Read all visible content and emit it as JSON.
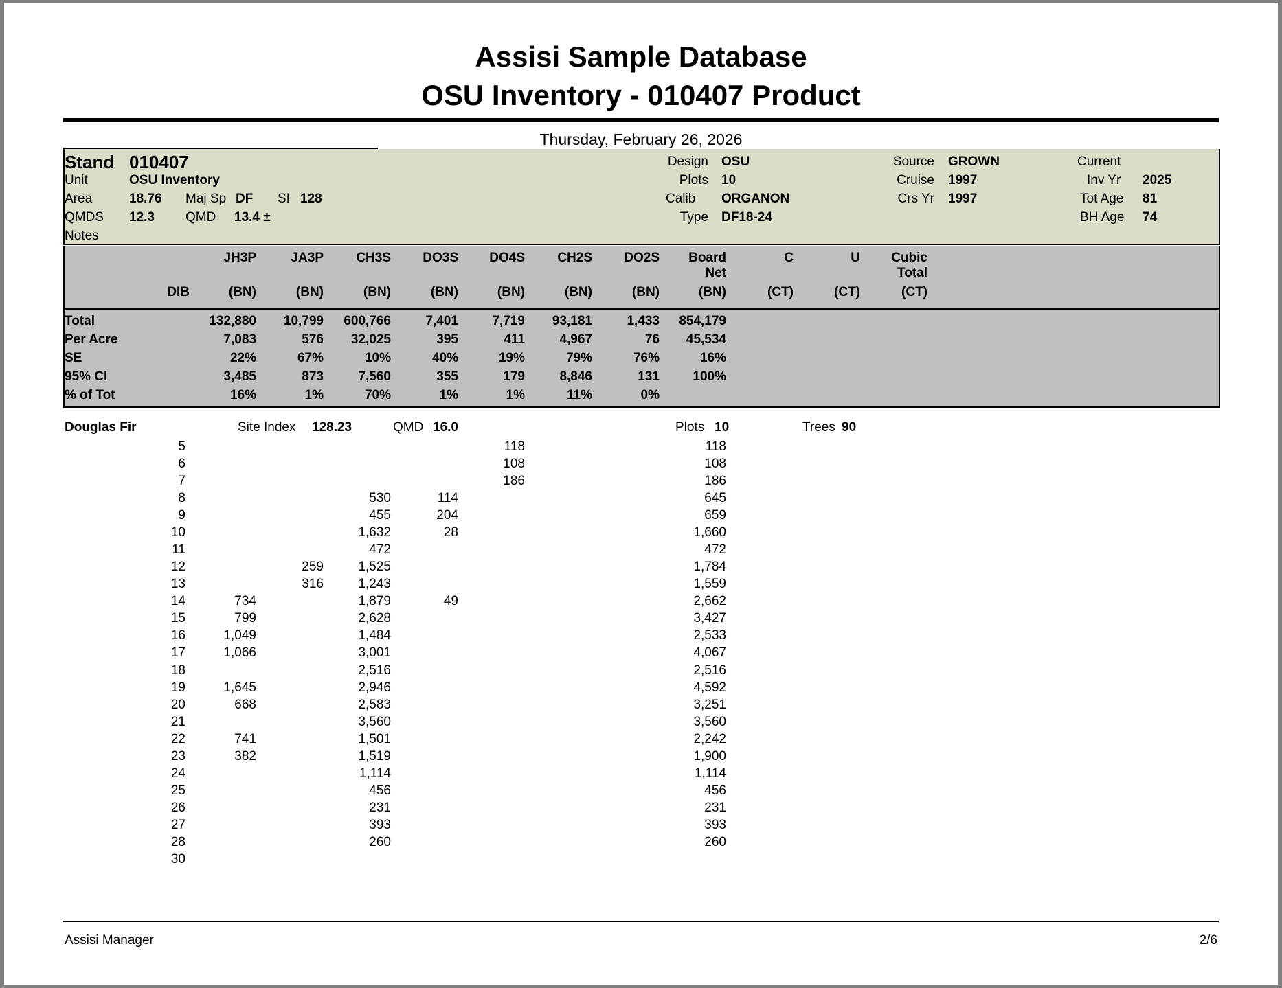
{
  "report": {
    "title_line1": "Assisi Sample Database",
    "title_line2": "OSU Inventory - 010407 Product",
    "date": "Thursday, February 26, 2026"
  },
  "stand": {
    "stand_label": "Stand",
    "stand_value": "010407",
    "unit_label": "Unit",
    "unit_value": "OSU Inventory",
    "area_label": "Area",
    "area_value": "18.76",
    "majsp_label": "Maj Sp",
    "majsp_value": "DF",
    "si_label": "SI",
    "si_value": "128",
    "qmds_label": "QMDS",
    "qmds_value": "12.3",
    "qmd_label": "QMD",
    "qmd_value": "13.4 ±",
    "notes_label": "Notes",
    "design_label": "Design",
    "design_value": "OSU",
    "plots_label": "Plots",
    "plots_value": "10",
    "calib_label": "Calib",
    "calib_value": "ORGANON",
    "type_label": "Type",
    "type_value": "DF18-24",
    "source_label": "Source",
    "source_value": "GROWN",
    "cruise_label": "Cruise",
    "cruise_value": "1997",
    "crsyr_label": "Crs Yr",
    "crsyr_value": "1997",
    "current_label": "Current",
    "invyr_label": "Inv Yr",
    "invyr_value": "2025",
    "totage_label": "Tot Age",
    "totage_value": "81",
    "bhage_label": "BH Age",
    "bhage_value": "74"
  },
  "header": {
    "dib": "DIB",
    "columns": [
      {
        "top": "JH3P",
        "mid": "",
        "unit": "(BN)"
      },
      {
        "top": "JA3P",
        "mid": "",
        "unit": "(BN)"
      },
      {
        "top": "CH3S",
        "mid": "",
        "unit": "(BN)"
      },
      {
        "top": "DO3S",
        "mid": "",
        "unit": "(BN)"
      },
      {
        "top": "DO4S",
        "mid": "",
        "unit": "(BN)"
      },
      {
        "top": "CH2S",
        "mid": "",
        "unit": "(BN)"
      },
      {
        "top": "DO2S",
        "mid": "",
        "unit": "(BN)"
      },
      {
        "top": "Board",
        "mid": "Net",
        "unit": "(BN)"
      },
      {
        "top": "C",
        "mid": "",
        "unit": "(CT)"
      },
      {
        "top": "U",
        "mid": "",
        "unit": "(CT)"
      },
      {
        "top": "Cubic",
        "mid": "Total",
        "unit": "(CT)"
      }
    ]
  },
  "summary": [
    {
      "label": "Total",
      "values": [
        "132,880",
        "10,799",
        "600,766",
        "7,401",
        "7,719",
        "93,181",
        "1,433",
        "854,179"
      ]
    },
    {
      "label": "Per Acre",
      "values": [
        "7,083",
        "576",
        "32,025",
        "395",
        "411",
        "4,967",
        "76",
        "45,534"
      ]
    },
    {
      "label": "SE",
      "values": [
        "22%",
        "67%",
        "10%",
        "40%",
        "19%",
        "79%",
        "76%",
        "16%"
      ]
    },
    {
      "label": "95% CI",
      "values": [
        "3,485",
        "873",
        "7,560",
        "355",
        "179",
        "8,846",
        "131",
        "100%"
      ]
    },
    {
      "label": "% of Tot",
      "values": [
        "16%",
        "1%",
        "70%",
        "1%",
        "1%",
        "11%",
        "0%",
        ""
      ]
    }
  ],
  "species": {
    "name": "Douglas Fir",
    "site_index_label": "Site Index",
    "site_index_value": "128.23",
    "qmd_label": "QMD",
    "qmd_value": "16.0",
    "plots_label": "Plots",
    "plots_value": "10",
    "trees_label": "Trees",
    "trees_value": "90"
  },
  "rows": [
    {
      "dib": "5",
      "values": [
        "",
        "",
        "",
        "",
        "118",
        "",
        "",
        "118"
      ]
    },
    {
      "dib": "6",
      "values": [
        "",
        "",
        "",
        "",
        "108",
        "",
        "",
        "108"
      ]
    },
    {
      "dib": "7",
      "values": [
        "",
        "",
        "",
        "",
        "186",
        "",
        "",
        "186"
      ]
    },
    {
      "dib": "8",
      "values": [
        "",
        "",
        "530",
        "114",
        "",
        "",
        "",
        "645"
      ]
    },
    {
      "dib": "9",
      "values": [
        "",
        "",
        "455",
        "204",
        "",
        "",
        "",
        "659"
      ]
    },
    {
      "dib": "10",
      "values": [
        "",
        "",
        "1,632",
        "28",
        "",
        "",
        "",
        "1,660"
      ]
    },
    {
      "dib": "11",
      "values": [
        "",
        "",
        "472",
        "",
        "",
        "",
        "",
        "472"
      ]
    },
    {
      "dib": "12",
      "values": [
        "",
        "259",
        "1,525",
        "",
        "",
        "",
        "",
        "1,784"
      ]
    },
    {
      "dib": "13",
      "values": [
        "",
        "316",
        "1,243",
        "",
        "",
        "",
        "",
        "1,559"
      ]
    },
    {
      "dib": "14",
      "values": [
        "734",
        "",
        "1,879",
        "49",
        "",
        "",
        "",
        "2,662"
      ]
    },
    {
      "dib": "15",
      "values": [
        "799",
        "",
        "2,628",
        "",
        "",
        "",
        "",
        "3,427"
      ]
    },
    {
      "dib": "16",
      "values": [
        "1,049",
        "",
        "1,484",
        "",
        "",
        "",
        "",
        "2,533"
      ]
    },
    {
      "dib": "17",
      "values": [
        "1,066",
        "",
        "3,001",
        "",
        "",
        "",
        "",
        "4,067"
      ]
    },
    {
      "dib": "18",
      "values": [
        "",
        "",
        "2,516",
        "",
        "",
        "",
        "",
        "2,516"
      ]
    },
    {
      "dib": "19",
      "values": [
        "1,645",
        "",
        "2,946",
        "",
        "",
        "",
        "",
        "4,592"
      ]
    },
    {
      "dib": "20",
      "values": [
        "668",
        "",
        "2,583",
        "",
        "",
        "",
        "",
        "3,251"
      ]
    },
    {
      "dib": "21",
      "values": [
        "",
        "",
        "3,560",
        "",
        "",
        "",
        "",
        "3,560"
      ]
    },
    {
      "dib": "22",
      "values": [
        "741",
        "",
        "1,501",
        "",
        "",
        "",
        "",
        "2,242"
      ]
    },
    {
      "dib": "23",
      "values": [
        "382",
        "",
        "1,519",
        "",
        "",
        "",
        "",
        "1,900"
      ]
    },
    {
      "dib": "24",
      "values": [
        "",
        "",
        "1,114",
        "",
        "",
        "",
        "",
        "1,114"
      ]
    },
    {
      "dib": "25",
      "values": [
        "",
        "",
        "456",
        "",
        "",
        "",
        "",
        "456"
      ]
    },
    {
      "dib": "26",
      "values": [
        "",
        "",
        "231",
        "",
        "",
        "",
        "",
        "231"
      ]
    },
    {
      "dib": "27",
      "values": [
        "",
        "",
        "393",
        "",
        "",
        "",
        "",
        "393"
      ]
    },
    {
      "dib": "28",
      "values": [
        "",
        "",
        "260",
        "",
        "",
        "",
        "",
        "260"
      ]
    },
    {
      "dib": "30",
      "values": [
        "",
        "",
        "",
        "",
        "",
        "",
        "",
        ""
      ]
    }
  ],
  "footer": {
    "app": "Assisi Manager",
    "page": "2/6"
  },
  "colors": {
    "stand_band": "#dcdcc8",
    "table_band": "#c0c0c0"
  }
}
